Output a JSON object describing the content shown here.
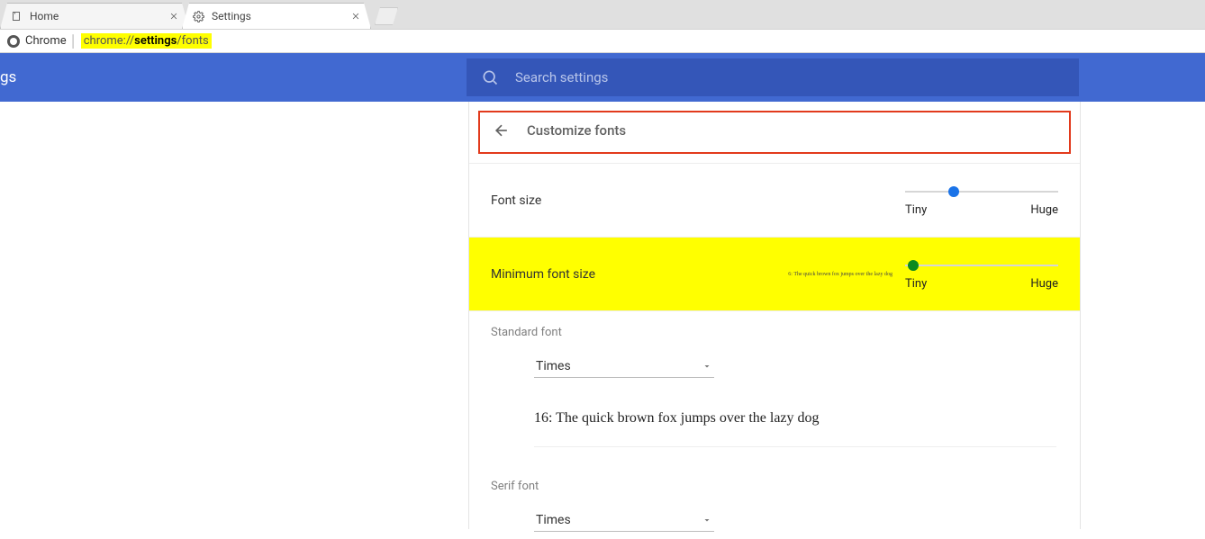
{
  "tabs": [
    {
      "title": "Home"
    },
    {
      "title": "Settings"
    }
  ],
  "omnibox": {
    "origin": "Chrome",
    "scheme": "chrome://",
    "host": "settings",
    "path": "/fonts"
  },
  "bluebar": {
    "heading_fragment": "gs"
  },
  "search": {
    "placeholder": "Search settings"
  },
  "subheader": {
    "title": "Customize fonts"
  },
  "font_size": {
    "label": "Font size",
    "min_label": "Tiny",
    "max_label": "Huge",
    "knob_pct": 28
  },
  "min_font_size": {
    "label": "Minimum font size",
    "sample": "6: The quick brown fox jumps over the lazy dog",
    "min_label": "Tiny",
    "max_label": "Huge",
    "knob_pct": 2
  },
  "standard_font": {
    "section_label": "Standard font",
    "value": "Times",
    "sample": "16: The quick brown fox jumps over the lazy dog"
  },
  "serif_font": {
    "section_label": "Serif font",
    "value": "Times"
  }
}
